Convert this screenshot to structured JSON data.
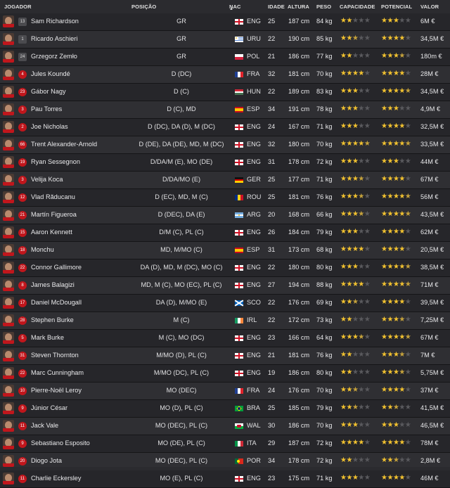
{
  "headers": {
    "player": "JOGADOR",
    "position": "POSIÇÃO",
    "nat": "NAC",
    "age": "IDADE",
    "height": "ALTURA",
    "weight": "PESO",
    "ability": "CAPACIDADE",
    "potential": "POTENCIAL",
    "value": "VALOR"
  },
  "sort_indicator_icon": "sort-arrow-up-icon",
  "star_colors": {
    "full": "#f2c230",
    "empty": "#5a5a5e"
  },
  "players": [
    {
      "number": "13",
      "gk": true,
      "name": "Sam Richardson",
      "position": "GR",
      "nat": "ENG",
      "age": "25",
      "height": "187 cm",
      "weight": "84 kg",
      "ability": 2,
      "potential": 3,
      "value": "6M €"
    },
    {
      "number": "1",
      "gk": true,
      "name": "Ricardo Aschieri",
      "position": "GR",
      "nat": "URU",
      "age": "22",
      "height": "190 cm",
      "weight": "85 kg",
      "ability": 2.5,
      "potential": 4,
      "value": "34,5M €"
    },
    {
      "number": "24",
      "gk": true,
      "name": "Grzegorz Zemło",
      "position": "GR",
      "nat": "POL",
      "age": "21",
      "height": "186 cm",
      "weight": "77 kg",
      "ability": 2,
      "potential": 3.5,
      "value": "180m €"
    },
    {
      "number": "4",
      "gk": false,
      "name": "Jules Koundé",
      "position": "D (DC)",
      "nat": "FRA",
      "age": "32",
      "height": "181 cm",
      "weight": "70 kg",
      "ability": 4,
      "potential": 4,
      "value": "28M €"
    },
    {
      "number": "23",
      "gk": false,
      "name": "Gábor Nagy",
      "position": "D (C)",
      "nat": "HUN",
      "age": "22",
      "height": "189 cm",
      "weight": "83 kg",
      "ability": 3,
      "potential": 4.5,
      "value": "34,5M €"
    },
    {
      "number": "3",
      "gk": false,
      "name": "Pau Torres",
      "position": "D (C), MD",
      "nat": "ESP",
      "age": "34",
      "height": "191 cm",
      "weight": "78 kg",
      "ability": 3,
      "potential": 3,
      "value": "4,9M €"
    },
    {
      "number": "2",
      "gk": false,
      "name": "Joe Nicholas",
      "position": "D (DC), DA (D), M (DC)",
      "nat": "ENG",
      "age": "24",
      "height": "167 cm",
      "weight": "71 kg",
      "ability": 3,
      "potential": 4,
      "value": "32,5M €"
    },
    {
      "number": "66",
      "gk": false,
      "name": "Trent Alexander-Arnold",
      "position": "D (DE), DA (DE), MD, M (DC)",
      "nat": "ENG",
      "age": "32",
      "height": "180 cm",
      "weight": "70 kg",
      "ability": 4.5,
      "potential": 4.5,
      "value": "33,5M €"
    },
    {
      "number": "19",
      "gk": false,
      "name": "Ryan Sessegnon",
      "position": "D/DA/M (E), MO (DE)",
      "nat": "ENG",
      "age": "31",
      "height": "178 cm",
      "weight": "72 kg",
      "ability": 3,
      "potential": 3,
      "value": "44M €"
    },
    {
      "number": "3",
      "gk": false,
      "name": "Velija Koca",
      "position": "D/DA/MO (E)",
      "nat": "GER",
      "age": "25",
      "height": "177 cm",
      "weight": "71 kg",
      "ability": 3.5,
      "potential": 4,
      "value": "67M €"
    },
    {
      "number": "12",
      "gk": false,
      "name": "Vlad Răducanu",
      "position": "D (EC), MD, M (C)",
      "nat": "ROU",
      "age": "25",
      "height": "181 cm",
      "weight": "76 kg",
      "ability": 3.5,
      "potential": 4.5,
      "value": "56M €"
    },
    {
      "number": "21",
      "gk": false,
      "name": "Martín Figueroa",
      "position": "D (DEC), DA (E)",
      "nat": "ARG",
      "age": "20",
      "height": "168 cm",
      "weight": "66 kg",
      "ability": 3.5,
      "potential": 4.5,
      "value": "43,5M €"
    },
    {
      "number": "15",
      "gk": false,
      "name": "Aaron Kennett",
      "position": "D/M (C), PL (C)",
      "nat": "ENG",
      "age": "26",
      "height": "184 cm",
      "weight": "79 kg",
      "ability": 3,
      "potential": 4,
      "value": "62M €"
    },
    {
      "number": "18",
      "gk": false,
      "name": "Monchu",
      "position": "MD, M/MO (C)",
      "nat": "ESP",
      "age": "31",
      "height": "173 cm",
      "weight": "68 kg",
      "ability": 4,
      "potential": 4,
      "value": "20,5M €"
    },
    {
      "number": "22",
      "gk": false,
      "name": "Connor Gallimore",
      "position": "DA (D), MD, M (DC), MO (C)",
      "nat": "ENG",
      "age": "22",
      "height": "180 cm",
      "weight": "80 kg",
      "ability": 3,
      "potential": 4.5,
      "value": "38,5M €"
    },
    {
      "number": "8",
      "gk": false,
      "name": "James Balagizi",
      "position": "MD, M (C), MO (EC), PL (C)",
      "nat": "ENG",
      "age": "27",
      "height": "194 cm",
      "weight": "88 kg",
      "ability": 4,
      "potential": 4.5,
      "value": "71M €"
    },
    {
      "number": "17",
      "gk": false,
      "name": "Daniel McDougall",
      "position": "DA (D), M/MO (E)",
      "nat": "SCO",
      "age": "22",
      "height": "176 cm",
      "weight": "69 kg",
      "ability": 2.5,
      "potential": 4,
      "value": "39,5M €"
    },
    {
      "number": "28",
      "gk": false,
      "name": "Stephen Burke",
      "position": "M (C)",
      "nat": "IRL",
      "age": "22",
      "height": "172 cm",
      "weight": "73 kg",
      "ability": 2,
      "potential": 3.5,
      "value": "7,25M €"
    },
    {
      "number": "5",
      "gk": false,
      "name": "Mark Burke",
      "position": "M (C), MO (DC)",
      "nat": "ENG",
      "age": "23",
      "height": "166 cm",
      "weight": "64 kg",
      "ability": 3.5,
      "potential": 4.5,
      "value": "67M €"
    },
    {
      "number": "31",
      "gk": false,
      "name": "Steven Thornton",
      "position": "M/MO (D), PL (C)",
      "nat": "ENG",
      "age": "21",
      "height": "181 cm",
      "weight": "76 kg",
      "ability": 2,
      "potential": 3.5,
      "value": "7M €"
    },
    {
      "number": "22",
      "gk": false,
      "name": "Marc Cunningham",
      "position": "M/MO (DC), PL (C)",
      "nat": "ENG",
      "age": "19",
      "height": "186 cm",
      "weight": "80 kg",
      "ability": 2,
      "potential": 3.5,
      "value": "5,75M €"
    },
    {
      "number": "10",
      "gk": false,
      "name": "Pierre-Noël Leroy",
      "position": "MO (DEC)",
      "nat": "FRA",
      "age": "24",
      "height": "176 cm",
      "weight": "70 kg",
      "ability": 2.5,
      "potential": 4,
      "value": "37M €"
    },
    {
      "number": "9",
      "gk": false,
      "name": "Júnior César",
      "position": "MO (D), PL (C)",
      "nat": "BRA",
      "age": "25",
      "height": "185 cm",
      "weight": "79 kg",
      "ability": 2.5,
      "potential": 2.5,
      "value": "41,5M €"
    },
    {
      "number": "11",
      "gk": false,
      "name": "Jack Vale",
      "position": "MO (DEC), PL (C)",
      "nat": "WAL",
      "age": "30",
      "height": "186 cm",
      "weight": "70 kg",
      "ability": 3,
      "potential": 3,
      "value": "46,5M €"
    },
    {
      "number": "9",
      "gk": false,
      "name": "Sebastiano Esposito",
      "position": "MO (DE), PL (C)",
      "nat": "ITA",
      "age": "29",
      "height": "187 cm",
      "weight": "72 kg",
      "ability": 4,
      "potential": 4,
      "value": "78M €"
    },
    {
      "number": "20",
      "gk": false,
      "name": "Diogo Jota",
      "position": "MO (DEC), PL (C)",
      "nat": "POR",
      "age": "34",
      "height": "178 cm",
      "weight": "72 kg",
      "ability": 2,
      "potential": 2.5,
      "value": "2,8M €"
    },
    {
      "number": "11",
      "gk": false,
      "name": "Charlie Eckersley",
      "position": "MO (E), PL (C)",
      "nat": "ENG",
      "age": "23",
      "height": "175 cm",
      "weight": "71 kg",
      "ability": 3,
      "potential": 4,
      "value": "46M €"
    }
  ]
}
